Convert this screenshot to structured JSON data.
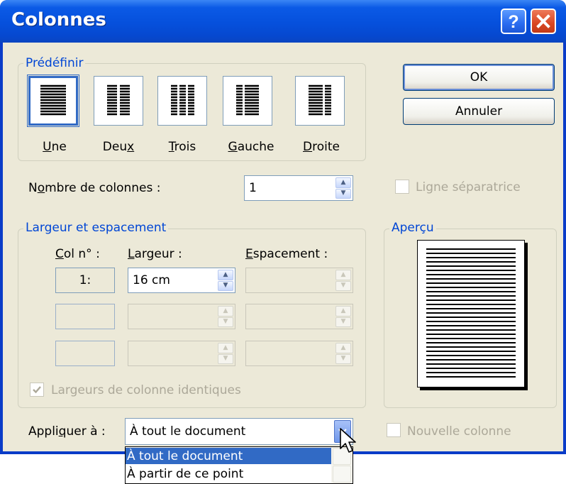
{
  "window": {
    "title": "Colonnes",
    "help_icon": "help-icon",
    "close_icon": "close-icon"
  },
  "presets": {
    "legend": "Prédéfinir",
    "items": [
      {
        "label": "Une",
        "accel": "U",
        "rest": "ne",
        "selected": true,
        "icon": "one-column-icon"
      },
      {
        "label": "Deux",
        "pre": "Deu",
        "accel": "x",
        "icon": "two-columns-icon"
      },
      {
        "label": "Trois",
        "accel": "T",
        "rest": "rois",
        "icon": "three-columns-icon"
      },
      {
        "label": "Gauche",
        "accel": "G",
        "rest": "auche",
        "icon": "left-column-icon"
      },
      {
        "label": "Droite",
        "accel": "D",
        "rest": "roite",
        "icon": "right-column-icon"
      }
    ]
  },
  "buttons": {
    "ok": "OK",
    "cancel": "Annuler"
  },
  "columns_count": {
    "label_pre": "N",
    "label_accel": "o",
    "label_rest": "mbre de colonnes :",
    "value": "1"
  },
  "separator_line": {
    "label": "Ligne séparatrice",
    "checked": false
  },
  "width_spacing": {
    "legend": "Largeur et espacement",
    "col_header_accel": "C",
    "col_header_rest": "ol n° :",
    "width_header_accel": "L",
    "width_header_rest": "argeur :",
    "spacing_header_accel": "E",
    "spacing_header_rest": "spacement :",
    "rows": [
      {
        "col": "1:",
        "width": "16 cm",
        "spacing": ""
      },
      {
        "col": "",
        "width": "",
        "spacing": ""
      },
      {
        "col": "",
        "width": "",
        "spacing": ""
      }
    ],
    "equal_widths": {
      "label": "Largeurs de colonne identiques",
      "checked": true
    }
  },
  "preview": {
    "legend": "Aperçu"
  },
  "apply_to": {
    "label_pre": "Appli",
    "label_accel": "q",
    "label_rest": "uer à :",
    "value": "À tout le document",
    "options": [
      "À tout le document",
      "À partir de ce point"
    ]
  },
  "new_column": {
    "label": "Nouvelle colonne",
    "checked": false
  },
  "colors": {
    "title_bar": "#0650dc",
    "dialog_bg": "#ece9d8",
    "accent": "#0046d5",
    "selection": "#316ac5"
  }
}
